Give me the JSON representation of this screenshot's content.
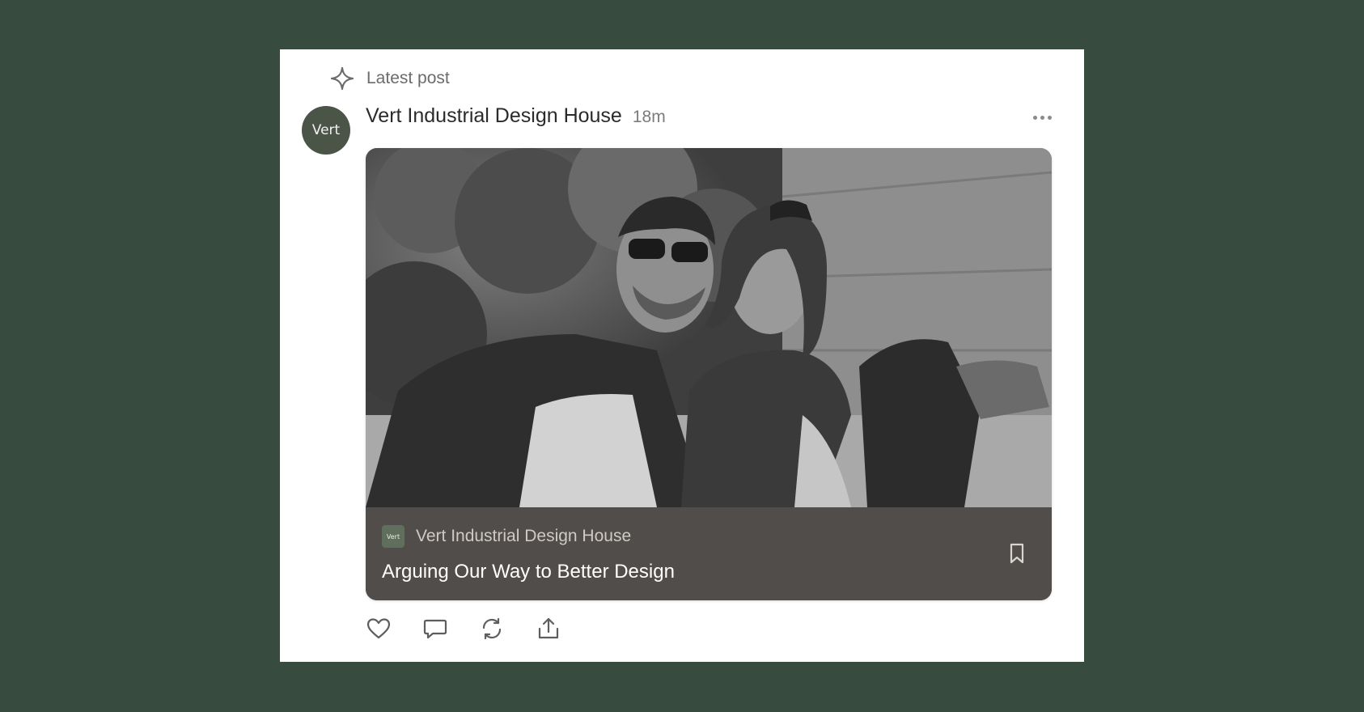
{
  "post": {
    "section_label": "Latest post",
    "avatar_text": "Vert",
    "author": "Vert Industrial Design House",
    "time": "18m"
  },
  "embed": {
    "publication_logo_text": "Vert",
    "publication": "Vert Industrial Design House",
    "title": "Arguing Our Way to Better Design"
  },
  "colors": {
    "page_background": "#374b3f",
    "card_background": "#ffffff",
    "embed_footer": "#504d4b",
    "avatar": "#4a5548"
  },
  "icons": {
    "section": "sparkle-icon",
    "more": "more-horizontal-icon",
    "bookmark": "bookmark-icon",
    "like": "heart-icon",
    "comment": "comment-icon",
    "restack": "restack-icon",
    "share": "share-icon"
  }
}
